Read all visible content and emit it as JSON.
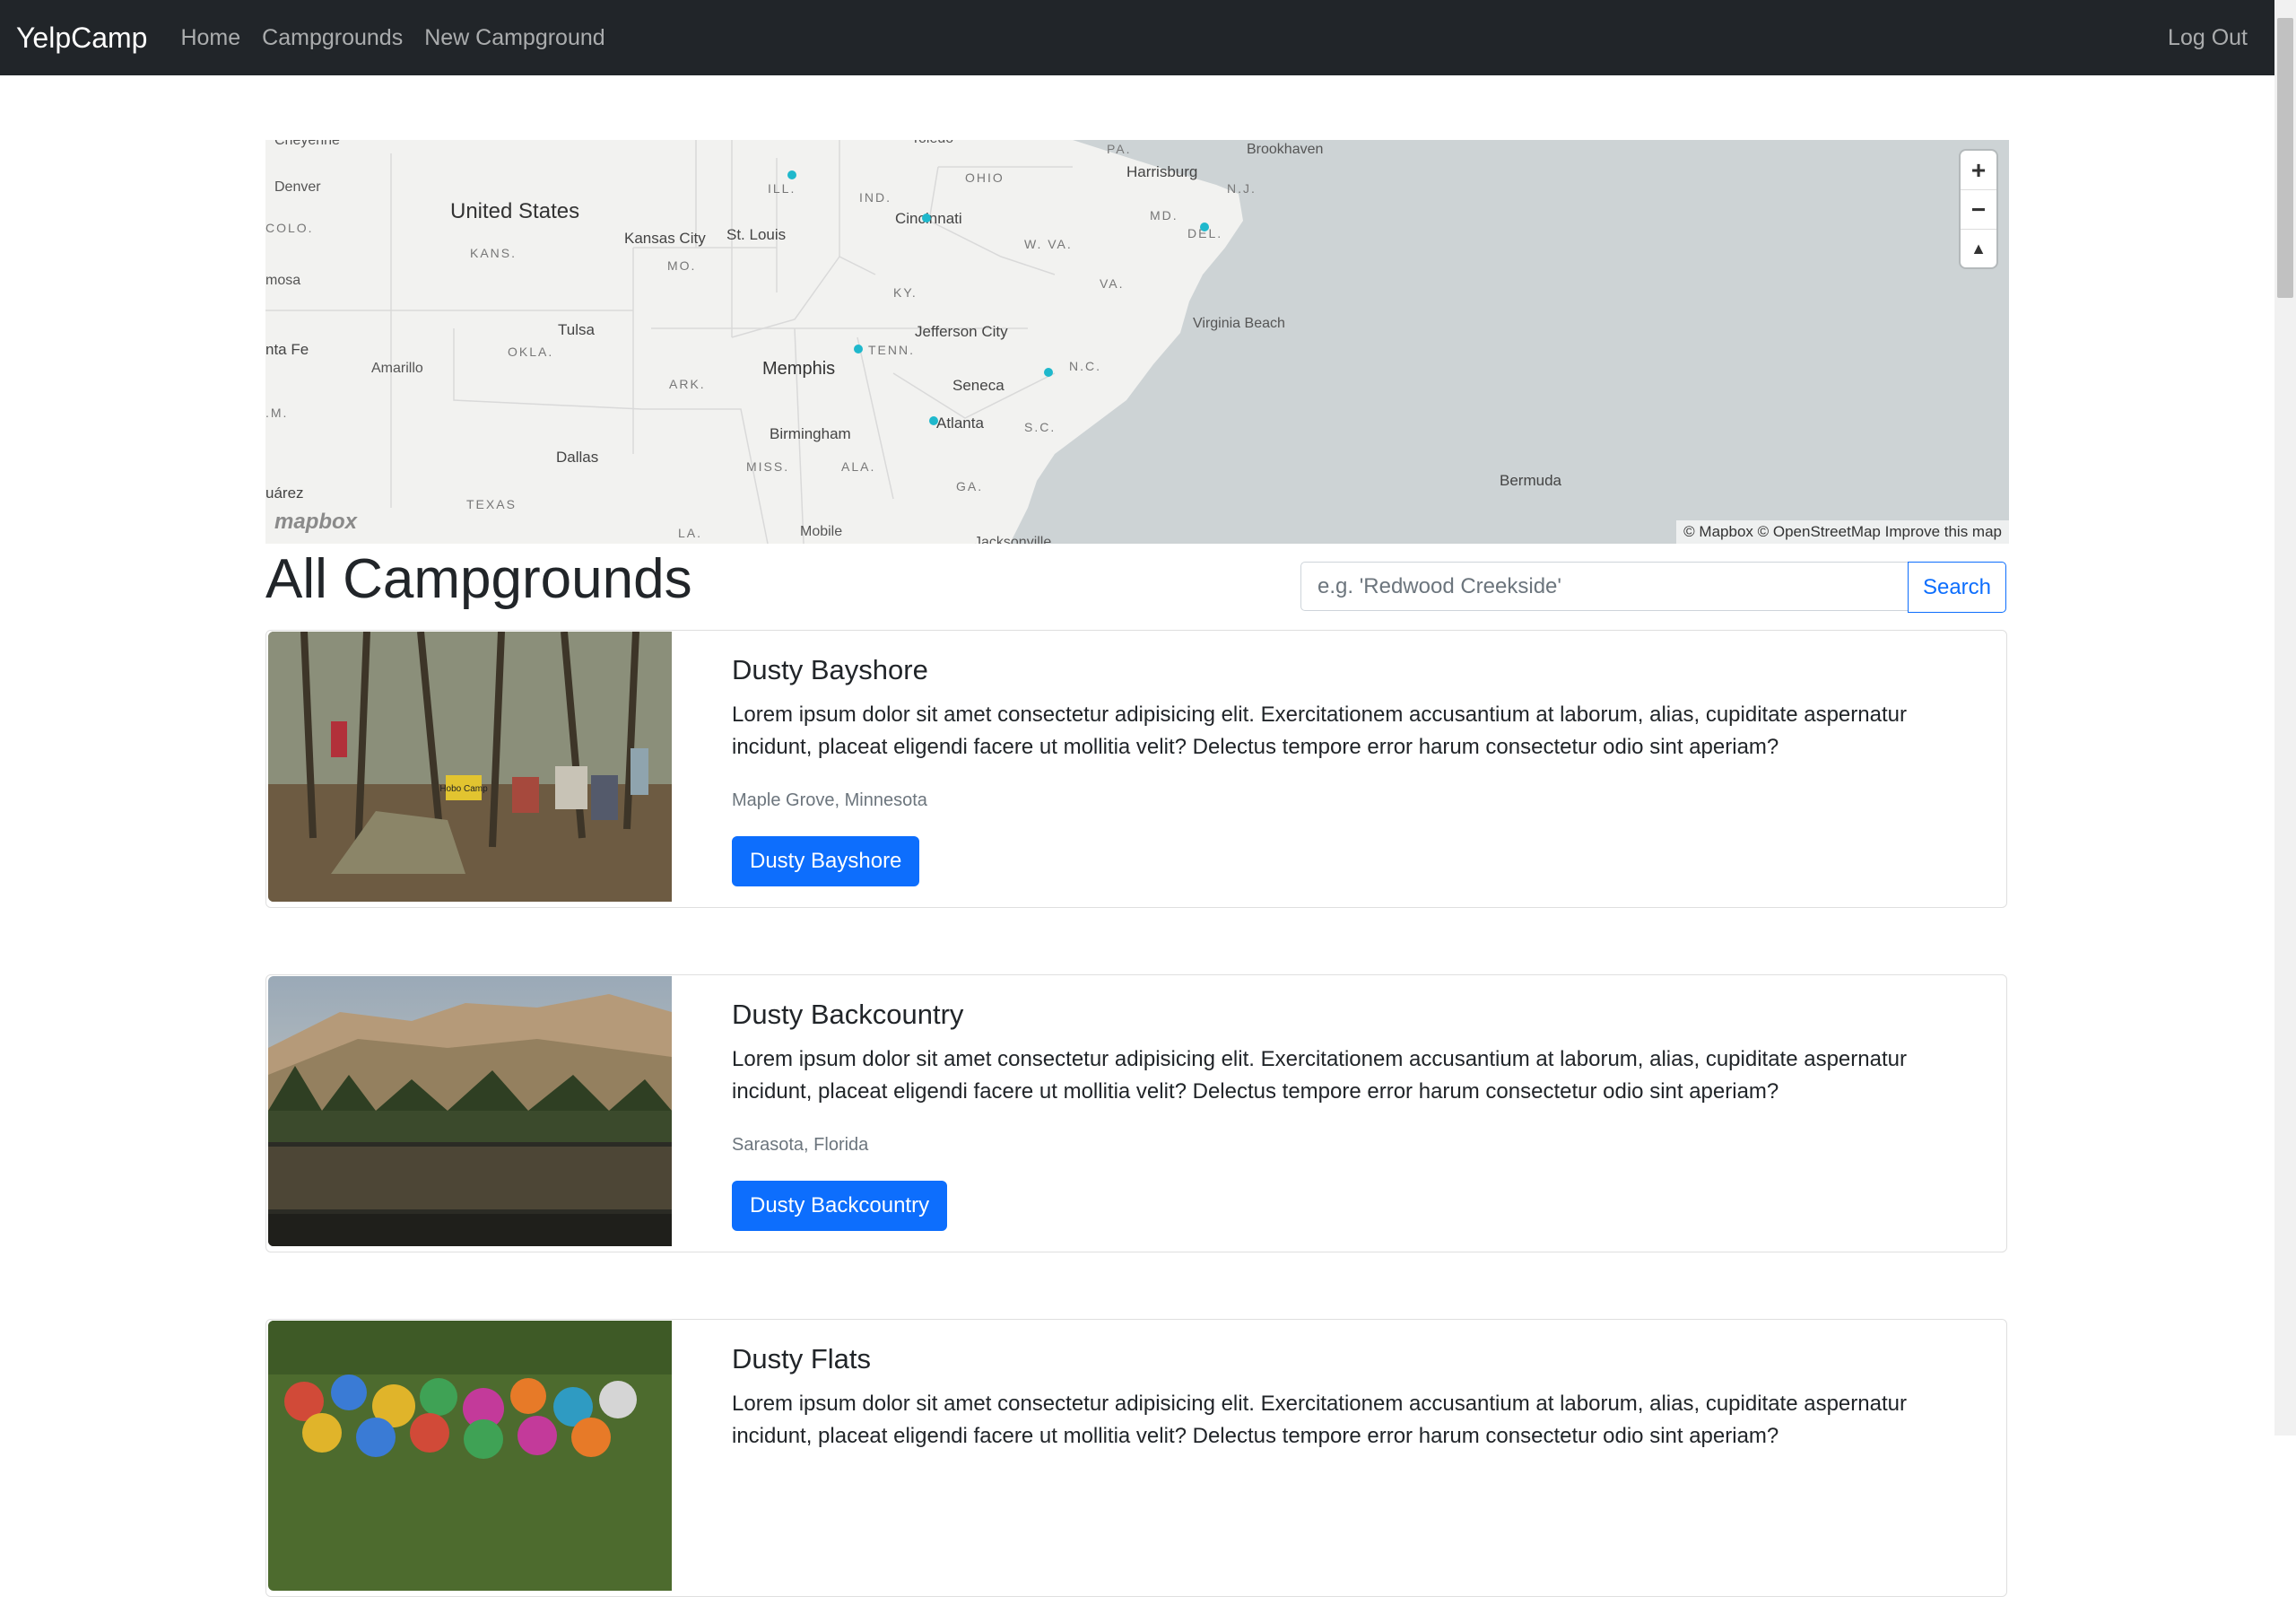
{
  "nav": {
    "brand": "YelpCamp",
    "links": [
      "Home",
      "Campgrounds",
      "New Campground"
    ],
    "logout": "Log Out"
  },
  "map": {
    "labels": {
      "united_states": "United States",
      "denver": "Denver",
      "colo": "COLO.",
      "kans": "KANS.",
      "kansas_city": "Kansas City",
      "st_louis": "St. Louis",
      "mo": "MO.",
      "ill": "ILL.",
      "ind": "IND.",
      "ohio": "OHIO",
      "pa": "PA.",
      "harrisburg": "Harrisburg",
      "brookhaven": "Brookhaven",
      "nj": "N.J.",
      "md": "MD.",
      "del": "DEL.",
      "cincinnati": "Cincinnati",
      "wva": "W. VA.",
      "va": "VA.",
      "ky": "KY.",
      "virginia_beach": "Virginia Beach",
      "jefferson_city": "Jefferson City",
      "tenn": "TENN.",
      "nc": "N.C.",
      "memphis": "Memphis",
      "seneca": "Seneca",
      "ark": "ARK.",
      "okla": "OKLA.",
      "tulsa": "Tulsa",
      "amarillo": "Amarillo",
      "santa_fe": "nta Fe",
      "nm": ".M.",
      "mosa": "mosa",
      "birmingham": "Birmingham",
      "atlanta": "Atlanta",
      "sc": "S.C.",
      "miss": "MISS.",
      "ala": "ALA.",
      "ga": "GA.",
      "dallas": "Dallas",
      "texas": "TEXAS",
      "juarez": "uárez",
      "la": "LA.",
      "mobile": "Mobile",
      "bermuda": "Bermuda",
      "cheyenne": "Cheyenne",
      "toledo": "Toledo",
      "jacksonville": "Jacksonville"
    },
    "controls": {
      "zoom_in": "+",
      "zoom_out": "−",
      "compass": "▲"
    },
    "logo": "mapbox",
    "attribution": "© Mapbox © OpenStreetMap Improve this map",
    "marker_color": "#1fb8cc"
  },
  "page": {
    "heading": "All Campgrounds",
    "search_placeholder": "e.g. 'Redwood Creekside'",
    "search_button": "Search"
  },
  "campgrounds": [
    {
      "title": "Dusty Bayshore",
      "description": "Lorem ipsum dolor sit amet consectetur adipisicing elit. Exercitationem accusantium at laborum, alias, cupiditate aspernatur incidunt, placeat eligendi facere ut mollitia velit? Delectus tempore error harum consectetur odio sint aperiam?",
      "location": "Maple Grove, Minnesota",
      "button": "Dusty Bayshore",
      "image_sign": "Hobo Camp"
    },
    {
      "title": "Dusty Backcountry",
      "description": "Lorem ipsum dolor sit amet consectetur adipisicing elit. Exercitationem accusantium at laborum, alias, cupiditate aspernatur incidunt, placeat eligendi facere ut mollitia velit? Delectus tempore error harum consectetur odio sint aperiam?",
      "location": "Sarasota, Florida",
      "button": "Dusty Backcountry"
    },
    {
      "title": "Dusty Flats",
      "description": "Lorem ipsum dolor sit amet consectetur adipisicing elit. Exercitationem accusantium at laborum, alias, cupiditate aspernatur incidunt, placeat eligendi facere ut mollitia velit? Delectus tempore error harum consectetur odio sint aperiam?",
      "location": "",
      "button": "Dusty Flats"
    }
  ]
}
